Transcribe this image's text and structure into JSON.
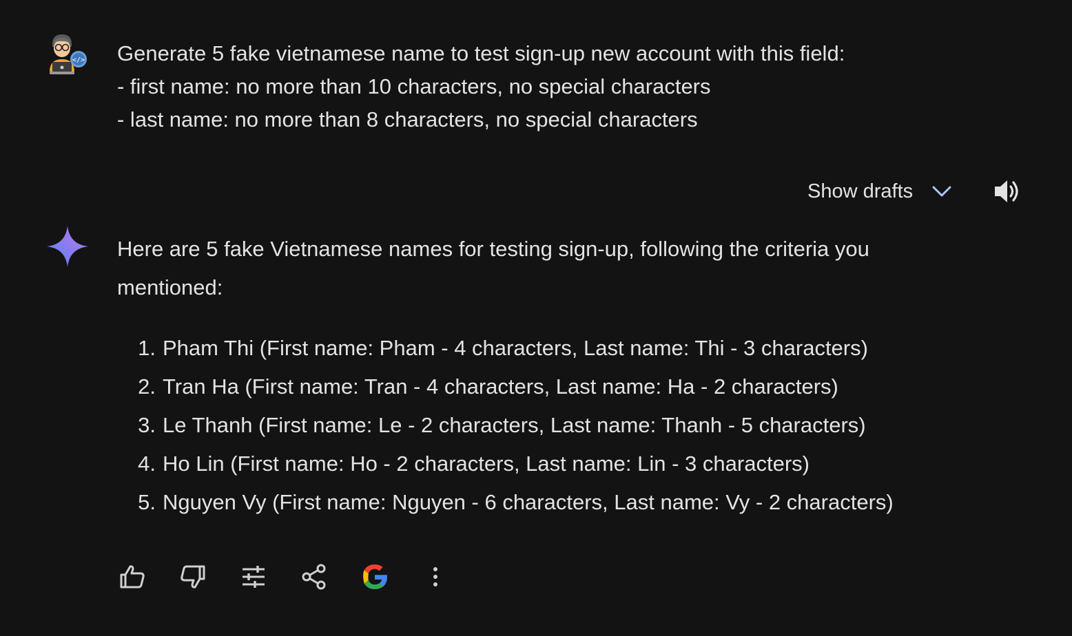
{
  "user_message": {
    "lines": [
      "Generate 5 fake vietnamese name to test sign-up new account with this field:",
      "- first name: no more than 10 characters, no special characters",
      "- last name: no more than 8 characters, no special characters"
    ]
  },
  "drafts": {
    "label": "Show drafts"
  },
  "response": {
    "intro": "Here are 5 fake Vietnamese names for testing sign-up, following the criteria you mentioned:",
    "items": [
      {
        "num": "1.",
        "text": "Pham Thi (First name: Pham - 4 characters, Last name: Thi - 3 characters)"
      },
      {
        "num": "2.",
        "text": "Tran Ha (First name: Tran - 4 characters, Last name: Ha - 2 characters)"
      },
      {
        "num": "3.",
        "text": "Le Thanh (First name: Le - 2 characters, Last name: Thanh - 5 characters)"
      },
      {
        "num": "4.",
        "text": "Ho Lin (First name: Ho - 2 characters, Last name: Lin - 3 characters)"
      },
      {
        "num": "5.",
        "text": "Nguyen Vy (First name: Nguyen - 6 characters, Last name: Vy - 2 characters)"
      }
    ]
  },
  "icons": {
    "user_avatar": "developer-avatar-icon",
    "assistant": "sparkle-icon",
    "drafts_toggle": "chevron-down-icon",
    "speaker": "speaker-icon",
    "actions": [
      "thumbs-up-icon",
      "thumbs-down-icon",
      "tune-icon",
      "share-icon",
      "google-icon",
      "more-vertical-icon"
    ]
  },
  "colors": {
    "background": "#131314",
    "text": "#e3e3e3",
    "chevron": "#a8c7fa",
    "google_blue": "#4285F4",
    "google_red": "#EA4335",
    "google_yellow": "#FBBC05",
    "google_green": "#34A853"
  }
}
